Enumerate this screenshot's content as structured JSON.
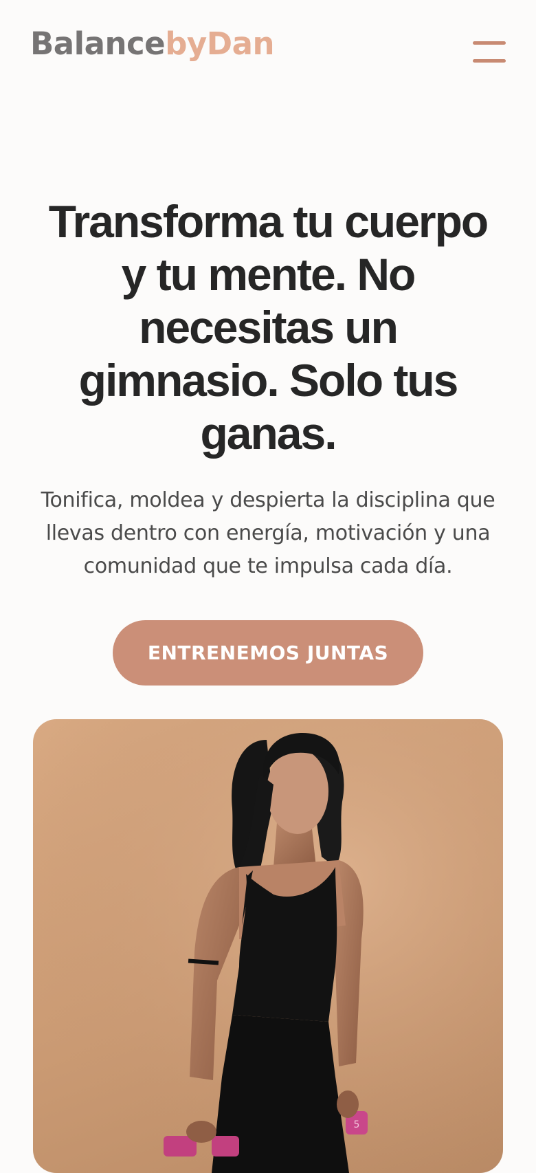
{
  "header": {
    "logo_part1": "Balance",
    "logo_part2": "byDan",
    "menu_icon": "hamburger-menu-icon"
  },
  "hero": {
    "title": "Transforma tu cuerpo y tu mente. No necesitas un gimnasio.  Solo tus ganas.",
    "subtitle": "Tonifica, moldea y despierta la disciplina que llevas dentro  con energía, motivación y una comunidad que te impulsa cada día.",
    "cta_label": "ENTRENEMOS JUNTAS"
  },
  "photo": {
    "dumbbell_label": "5"
  },
  "colors": {
    "accent": "#cb8f78",
    "logo_gray": "#767474",
    "logo_peach": "#e5ad92",
    "text_dark": "#262626",
    "background": "#fcfbfa"
  }
}
